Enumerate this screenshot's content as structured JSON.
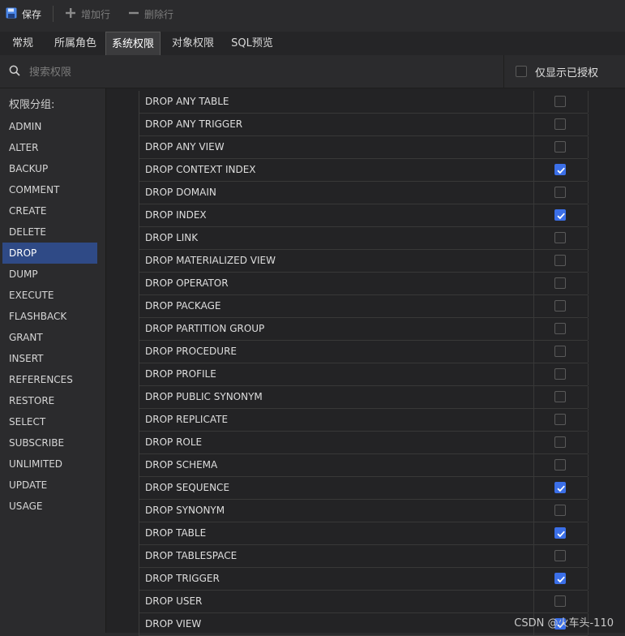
{
  "toolbar": {
    "save_label": "保存",
    "add_row_label": "增加行",
    "delete_row_label": "删除行"
  },
  "tabs": [
    {
      "label": "常规",
      "active": false
    },
    {
      "label": "所属角色",
      "active": false
    },
    {
      "label": "系统权限",
      "active": true
    },
    {
      "label": "对象权限",
      "active": false
    },
    {
      "label": "SQL预览",
      "active": false
    }
  ],
  "search": {
    "placeholder": "搜索权限",
    "value": ""
  },
  "filter": {
    "label": "仅显示已授权",
    "checked": false
  },
  "sidebar": {
    "title": "权限分组:",
    "groups": [
      "ADMIN",
      "ALTER",
      "BACKUP",
      "COMMENT",
      "CREATE",
      "DELETE",
      "DROP",
      "DUMP",
      "EXECUTE",
      "FLASHBACK",
      "GRANT",
      "INSERT",
      "REFERENCES",
      "RESTORE",
      "SELECT",
      "SUBSCRIBE",
      "UNLIMITED",
      "UPDATE",
      "USAGE"
    ],
    "selected": "DROP"
  },
  "privileges": [
    {
      "name": "DROP ANY TABLE",
      "granted": false
    },
    {
      "name": "DROP ANY TRIGGER",
      "granted": false
    },
    {
      "name": "DROP ANY VIEW",
      "granted": false
    },
    {
      "name": "DROP CONTEXT INDEX",
      "granted": true
    },
    {
      "name": "DROP DOMAIN",
      "granted": false
    },
    {
      "name": "DROP INDEX",
      "granted": true
    },
    {
      "name": "DROP LINK",
      "granted": false
    },
    {
      "name": "DROP MATERIALIZED VIEW",
      "granted": false
    },
    {
      "name": "DROP OPERATOR",
      "granted": false
    },
    {
      "name": "DROP PACKAGE",
      "granted": false
    },
    {
      "name": "DROP PARTITION GROUP",
      "granted": false
    },
    {
      "name": "DROP PROCEDURE",
      "granted": false
    },
    {
      "name": "DROP PROFILE",
      "granted": false
    },
    {
      "name": "DROP PUBLIC SYNONYM",
      "granted": false
    },
    {
      "name": "DROP REPLICATE",
      "granted": false
    },
    {
      "name": "DROP ROLE",
      "granted": false
    },
    {
      "name": "DROP SCHEMA",
      "granted": false
    },
    {
      "name": "DROP SEQUENCE",
      "granted": true
    },
    {
      "name": "DROP SYNONYM",
      "granted": false
    },
    {
      "name": "DROP TABLE",
      "granted": true
    },
    {
      "name": "DROP TABLESPACE",
      "granted": false
    },
    {
      "name": "DROP TRIGGER",
      "granted": true
    },
    {
      "name": "DROP USER",
      "granted": false
    },
    {
      "name": "DROP VIEW",
      "granted": true
    }
  ],
  "watermark": "CSDN @火车头-110",
  "colors": {
    "accent": "#3b6fe8",
    "selected_group": "#2f4a86",
    "save_icon": "#4a86e8"
  }
}
